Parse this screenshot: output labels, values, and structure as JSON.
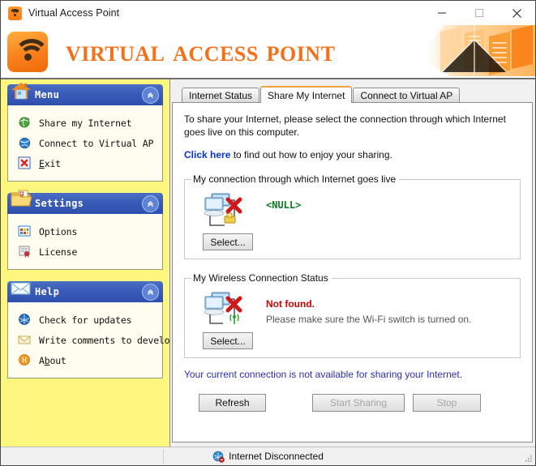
{
  "window": {
    "title": "Virtual Access Point",
    "icon": "wifi-icon",
    "controls": [
      {
        "name": "minimize",
        "glyph": "minimize-icon"
      },
      {
        "name": "maximize",
        "glyph": "maximize-icon"
      },
      {
        "name": "close",
        "glyph": "close-icon"
      }
    ]
  },
  "banner": {
    "title": "Virtual Access Point",
    "logo": "wifi-logo-icon",
    "accent_color": "#f4701a"
  },
  "sidebar": {
    "background_color": "#fdf77f",
    "panels": [
      {
        "title": "Menu",
        "icon": "house-icon",
        "collapse_icon": "chevron-up-icon",
        "items": [
          {
            "label": "Share my Internet",
            "icon": "globe-share-icon"
          },
          {
            "label": "Connect to Virtual AP",
            "icon": "globe-connect-icon"
          },
          {
            "label": "Exit",
            "icon": "close-red-icon",
            "underline": "E"
          }
        ]
      },
      {
        "title": "Settings",
        "icon": "folder-check-icon",
        "collapse_icon": "chevron-up-icon",
        "items": [
          {
            "label": "Options",
            "icon": "options-grid-icon"
          },
          {
            "label": "License",
            "icon": "license-certificate-icon"
          }
        ]
      },
      {
        "title": "Help",
        "icon": "envelope-icon",
        "collapse_icon": "chevron-up-icon",
        "items": [
          {
            "label": "Check for updates",
            "icon": "globe-update-icon"
          },
          {
            "label": "Write comments to developer",
            "icon": "mail-icon"
          },
          {
            "label": "About",
            "icon": "about-info-icon",
            "underline": "b"
          }
        ]
      }
    ]
  },
  "main": {
    "tabs": [
      {
        "label": "Internet Status",
        "active": false
      },
      {
        "label": "Share My Internet",
        "active": true
      },
      {
        "label": "Connect to Virtual AP",
        "active": false
      }
    ],
    "active_tab_accent": "#f2a33c",
    "intro": "To share your Internet, please select the connection through which Internet goes live on this computer.",
    "help_link_text": "Click here",
    "help_link_suffix": "to find out how to enjoy your sharing.",
    "connection_group": {
      "legend": "My connection  through which Internet goes live",
      "icon": "network-wired-error-icon",
      "value": "<NULL>",
      "value_color": "#0c7a22",
      "select_button": "Select..."
    },
    "wireless_group": {
      "legend": "My Wireless Connection Status",
      "icon": "network-wireless-error-icon",
      "status": "Not found.",
      "status_color": "#cc0000",
      "hint": "Please make sure the Wi-Fi switch is turned on.",
      "select_button": "Select..."
    },
    "warning": "Your current connection is not available for sharing your Internet.",
    "warning_color": "#2d2dbb",
    "buttons": [
      {
        "label": "Refresh",
        "enabled": true
      },
      {
        "label": "Start Sharing",
        "enabled": false
      },
      {
        "label": "Stop",
        "enabled": false
      }
    ]
  },
  "statusbar": {
    "icon": "globe-disconnected-icon",
    "text": "Internet Disconnected",
    "grip": "resize-grip-icon"
  }
}
